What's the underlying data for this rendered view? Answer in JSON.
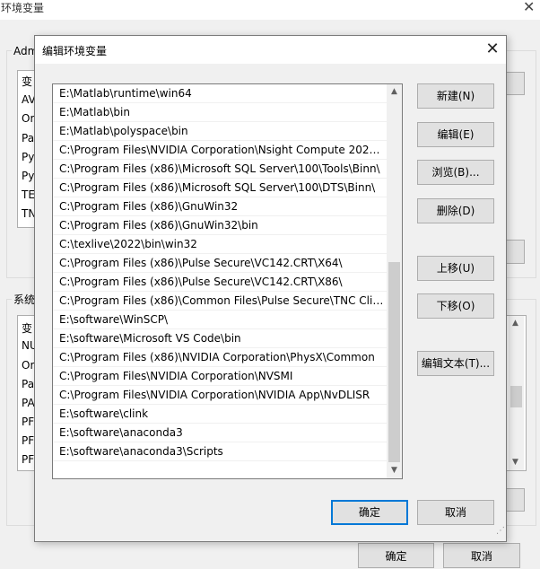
{
  "background_window": {
    "title": "环境变量",
    "close_glyph": "✕",
    "user_group_label": "Adm",
    "user_rows": [
      "变",
      "AV",
      "Or",
      "Pa",
      "Py",
      "Py",
      "TE",
      "TN"
    ],
    "system_group_label": "系统",
    "system_rows": [
      "变",
      "NU",
      "Or",
      "Pa",
      "PA",
      "PF",
      "PF",
      "PF"
    ],
    "ok_label": "确定",
    "cancel_label": "取消"
  },
  "dialog": {
    "title": "编辑环境变量",
    "close_glyph": "✕",
    "paths": [
      "E:\\Matlab\\runtime\\win64",
      "E:\\Matlab\\bin",
      "E:\\Matlab\\polyspace\\bin",
      "C:\\Program Files\\NVIDIA Corporation\\Nsight Compute 2020....",
      "C:\\Program Files (x86)\\Microsoft SQL Server\\100\\Tools\\Binn\\",
      "C:\\Program Files (x86)\\Microsoft SQL Server\\100\\DTS\\Binn\\",
      "C:\\Program Files (x86)\\GnuWin32",
      "C:\\Program Files (x86)\\GnuWin32\\bin",
      "C:\\texlive\\2022\\bin\\win32",
      "C:\\Program Files (x86)\\Pulse Secure\\VC142.CRT\\X64\\",
      "C:\\Program Files (x86)\\Pulse Secure\\VC142.CRT\\X86\\",
      "C:\\Program Files (x86)\\Common Files\\Pulse Secure\\TNC Clie...",
      "E:\\software\\WinSCP\\",
      "E:\\software\\Microsoft VS Code\\bin",
      "C:\\Program Files (x86)\\NVIDIA Corporation\\PhysX\\Common",
      "C:\\Program Files\\NVIDIA Corporation\\NVSMI",
      "C:\\Program Files\\NVIDIA Corporation\\NVIDIA App\\NvDLISR",
      "E:\\software\\clink",
      "E:\\software\\anaconda3",
      "E:\\software\\anaconda3\\Scripts",
      ""
    ],
    "buttons": {
      "new": "新建(N)",
      "edit": "编辑(E)",
      "browse": "浏览(B)...",
      "delete": "删除(D)",
      "move_up": "上移(U)",
      "move_down": "下移(O)",
      "edit_text": "编辑文本(T)...",
      "ok": "确定",
      "cancel": "取消"
    },
    "scroll": {
      "up_glyph": "▲",
      "down_glyph": "▼"
    },
    "resize_grip_glyph": "⋰"
  },
  "colors": {
    "accent": "#0078d7",
    "window_bg": "#f0f0f0",
    "button_bg": "#e1e1e1",
    "border": "#adadad"
  }
}
